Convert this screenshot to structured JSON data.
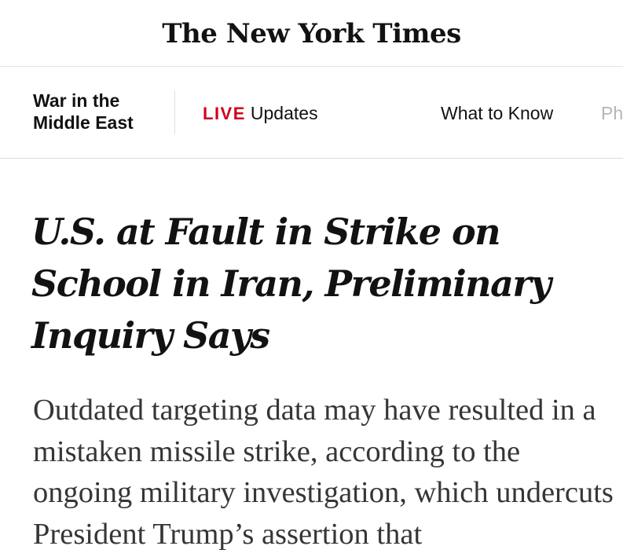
{
  "masthead": {
    "logo_text": "The New York Times"
  },
  "section_nav": {
    "section_title_line1": "War in the",
    "section_title_line2": "Middle East",
    "live_label": "LIVE",
    "live_link": "Updates",
    "what_to_know": "What to Know",
    "truncated_item": "Ph"
  },
  "article": {
    "headline": "U.S. at Fault in Strike on School in Iran, Preliminary Inquiry Says",
    "summary": "Outdated targeting data may have resulted in a mistaken missile strike, according to the ongoing military investigation, which undercuts President Trump’s assertion that"
  }
}
